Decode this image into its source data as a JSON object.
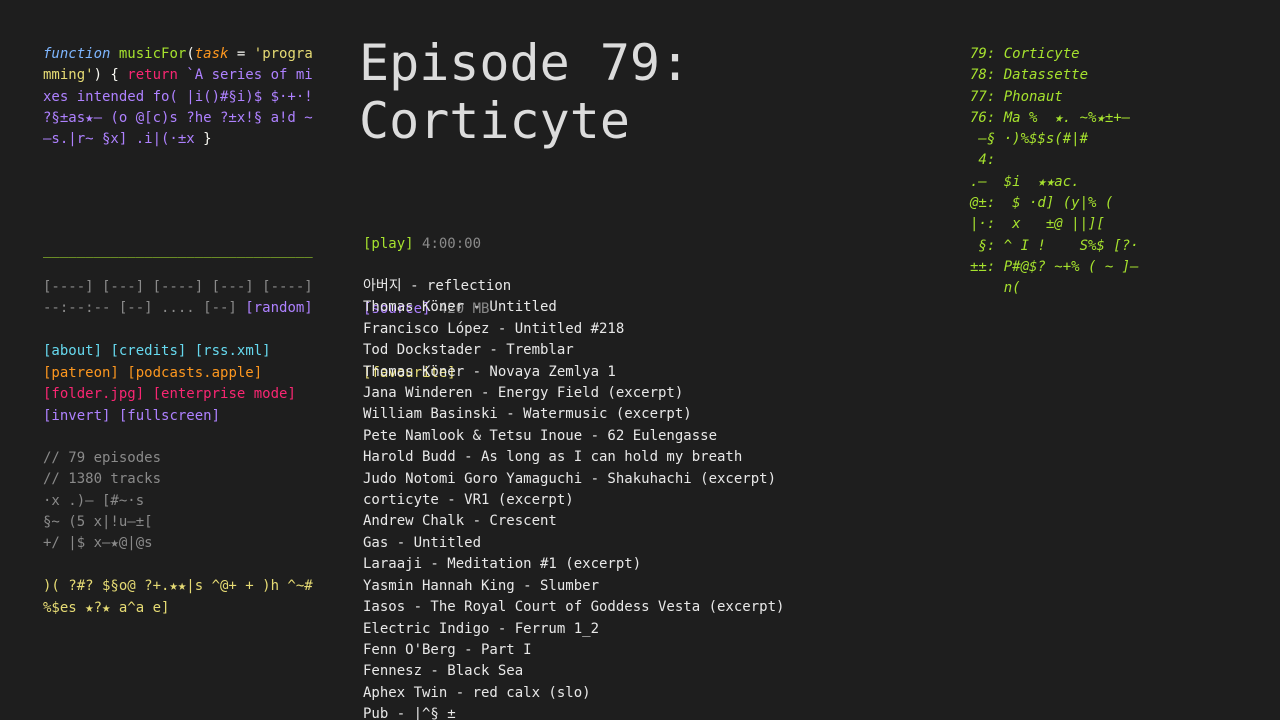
{
  "code": {
    "lines": [
      [
        "function",
        " ",
        "musicFor",
        "(",
        "task",
        " = ",
        "'progra"
      ],
      [
        "mming'",
        ") { ",
        "return",
        " `A series of mi"
      ],
      [
        "xes intended fo( |i()#§i)$ $·+·!"
      ],
      [
        "?§±as★— (o @[c)s ?he ?±x!§ a!d ~"
      ],
      [
        "—s.|r~ §x] .i|(·±x ",
        "}"
      ]
    ]
  },
  "separator": "________________________________",
  "player": {
    "row1": "[----] [---] [----] [---] [----]",
    "row2_prefix": "--:--:-- [--] .... [--] ",
    "random": "[random]"
  },
  "links": {
    "about": "[about]",
    "credits": "[credits]",
    "rss": "[rss.xml]",
    "patreon": "[patreon]",
    "podcasts": "[podcasts.apple]",
    "folder": "[folder.jpg]",
    "enterprise": "[enterprise mode]",
    "invert": "[invert]",
    "fullscreen": "[fullscreen]"
  },
  "stats": {
    "episodes": "// 79 episodes",
    "tracks": "// 1380 tracks",
    "g1": "·x .)— [#~·s",
    "g2": "§~ (5 x|!u—±[",
    "g3": "+/ |$ x—★@|@s"
  },
  "glitch_yellow": {
    "l1": ")( ?#? $§o@ ?+.★★|s ^@+ + )h ^~#",
    "l2": "%$es ★?★ a^a e]"
  },
  "episode": {
    "title_line1": "Episode 79:",
    "title_line2": "Corticyte",
    "play_label": "[play]",
    "duration": "4:00:00",
    "source_label": "[source]",
    "size": "420 MB",
    "favourite_label": "[favourite]"
  },
  "tracks": [
    "아버지 - reflection",
    "Thomas Köner - Untitled",
    "Francisco López - Untitled #218",
    "Tod Dockstader - Tremblar",
    "Thomas Köner - Novaya Zemlya 1",
    "Jana Winderen - Energy Field (excerpt)",
    "William Basinski - Watermusic (excerpt)",
    "Pete Namlook & Tetsu Inoue - 62 Eulengasse",
    "Harold Budd - As long as I can hold my breath",
    "Judo Notomi Goro Yamaguchi - Shakuhachi (excerpt)",
    "corticyte - VR1 (excerpt)",
    "Andrew Chalk - Crescent",
    "Gas - Untitled",
    "Laraaji - Meditation #1 (excerpt)",
    "Yasmin Hannah King - Slumber",
    "Iasos - The Royal Court of Goddess Vesta (excerpt)",
    "Electric Indigo - Ferrum 1_2",
    "Fenn O'Berg - Part I",
    "Fennesz - Black Sea",
    "Aphex Twin - red calx (slo)",
    "Pub - |^§ ±"
  ],
  "episode_list": [
    "79: Corticyte",
    "78: Datassette",
    "77: Phonaut",
    "76: Ma %  ★. ~%★±+—"
  ],
  "glitch_green": [
    " —§ ·)%$$s(#|#",
    " 4:",
    ".—  $i  ★★ac.",
    "@±:  $ ·d] (y|% (",
    "|·:  x   ±@ ||][",
    " §: ^ I !    S%$ [?·",
    "±±: P#@$? ~+% ( ~ ]—",
    "    n("
  ],
  "colors": {
    "background": "#1e1e1e",
    "green": "#a6e22e",
    "purple": "#ae81ff",
    "orange": "#fd971f",
    "pink": "#f92672",
    "blue": "#66d9ef",
    "yellow": "#e6db74",
    "gray": "#8a8a8a"
  }
}
